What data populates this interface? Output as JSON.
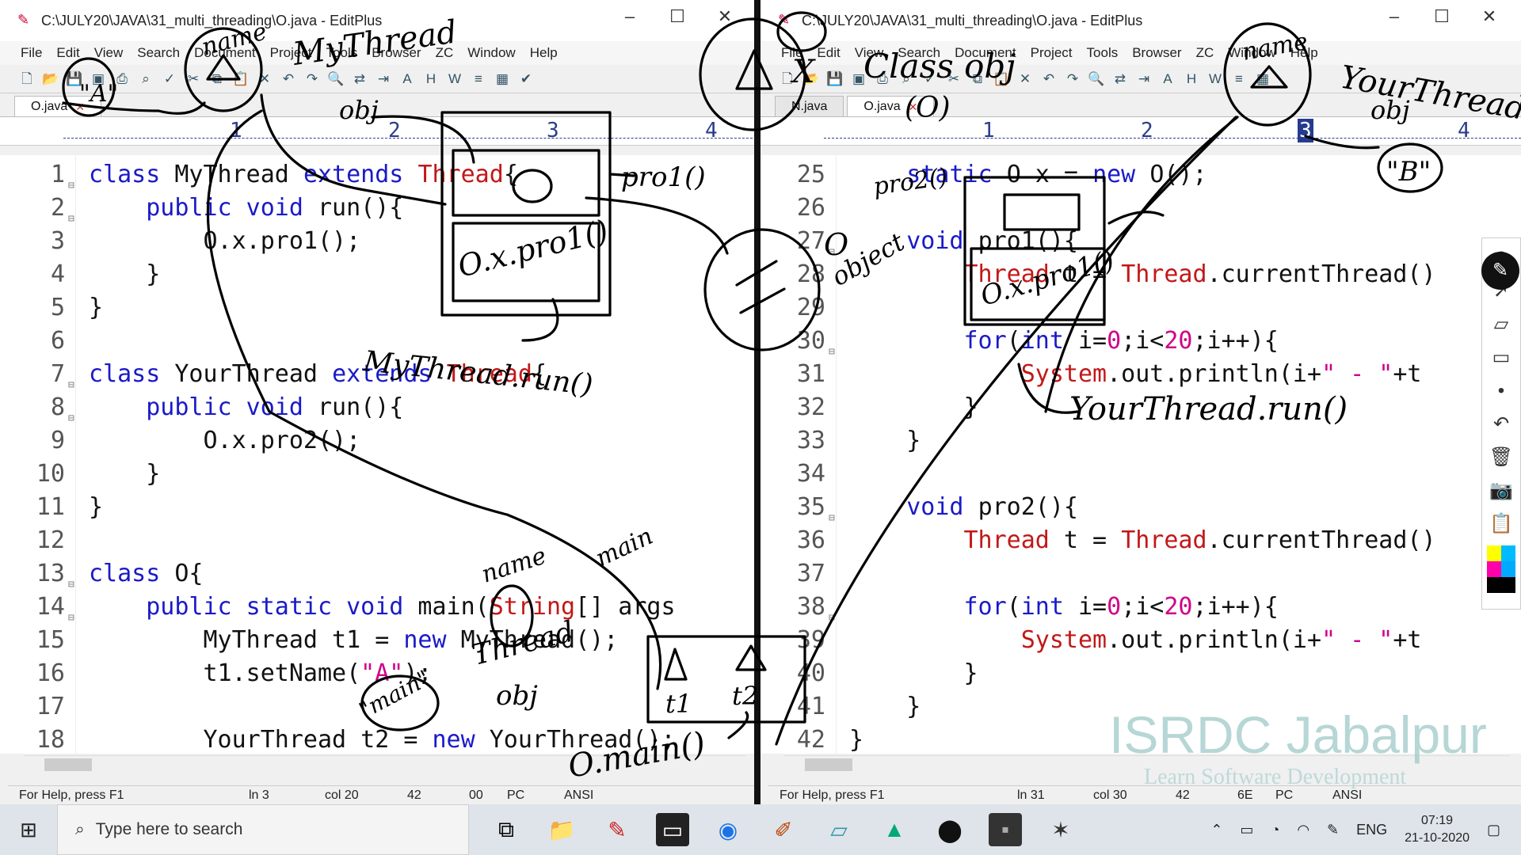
{
  "left_window": {
    "title": "C:\\JULY20\\JAVA\\31_multi_threading\\O.java - EditPlus",
    "menu": [
      "File",
      "Edit",
      "View",
      "Search",
      "Document",
      "Project",
      "Tools",
      "Browser",
      "ZC",
      "Window",
      "Help"
    ],
    "tabs": [
      {
        "label": "O.java",
        "active": true
      }
    ],
    "ruler": [
      "1",
      "2",
      "3",
      "4"
    ],
    "lines": [
      {
        "n": "1",
        "fold": "⊟",
        "segs": [
          [
            "kw",
            "class "
          ],
          [
            "txt",
            "MyThread "
          ],
          [
            "kw",
            "extends "
          ],
          [
            "cls",
            "Thread"
          ],
          [
            "txt",
            "{"
          ]
        ]
      },
      {
        "n": "2",
        "fold": "⊟",
        "segs": [
          [
            "txt",
            "    "
          ],
          [
            "kw",
            "public void "
          ],
          [
            "txt",
            "run(){"
          ]
        ]
      },
      {
        "n": "3",
        "fold": "",
        "segs": [
          [
            "txt",
            "        O.x.pro1();"
          ]
        ]
      },
      {
        "n": "4",
        "fold": "",
        "segs": [
          [
            "txt",
            "    }"
          ]
        ]
      },
      {
        "n": "5",
        "fold": "",
        "segs": [
          [
            "txt",
            "}"
          ]
        ]
      },
      {
        "n": "6",
        "fold": "",
        "segs": [
          [
            "txt",
            ""
          ]
        ]
      },
      {
        "n": "7",
        "fold": "⊟",
        "segs": [
          [
            "kw",
            "class "
          ],
          [
            "txt",
            "YourThread "
          ],
          [
            "kw",
            "extends "
          ],
          [
            "cls",
            "Thread"
          ],
          [
            "txt",
            "{"
          ]
        ]
      },
      {
        "n": "8",
        "fold": "⊟",
        "segs": [
          [
            "txt",
            "    "
          ],
          [
            "kw",
            "public void "
          ],
          [
            "txt",
            "run(){"
          ]
        ]
      },
      {
        "n": "9",
        "fold": "",
        "segs": [
          [
            "txt",
            "        O.x.pro2();"
          ]
        ]
      },
      {
        "n": "10",
        "fold": "",
        "segs": [
          [
            "txt",
            "    }"
          ]
        ]
      },
      {
        "n": "11",
        "fold": "",
        "segs": [
          [
            "txt",
            "}"
          ]
        ]
      },
      {
        "n": "12",
        "fold": "",
        "segs": [
          [
            "txt",
            ""
          ]
        ]
      },
      {
        "n": "13",
        "fold": "⊟",
        "segs": [
          [
            "kw",
            "class "
          ],
          [
            "txt",
            "O{"
          ]
        ]
      },
      {
        "n": "14",
        "fold": "⊟",
        "segs": [
          [
            "txt",
            "    "
          ],
          [
            "kw",
            "public static void "
          ],
          [
            "txt",
            "main("
          ],
          [
            "cls",
            "String"
          ],
          [
            "txt",
            "[] args"
          ]
        ]
      },
      {
        "n": "15",
        "fold": "",
        "segs": [
          [
            "txt",
            "        MyThread t1 = "
          ],
          [
            "kw",
            "new "
          ],
          [
            "txt",
            "MyThread();"
          ]
        ]
      },
      {
        "n": "16",
        "fold": "",
        "segs": [
          [
            "txt",
            "        t1.setName("
          ],
          [
            "str",
            "\"A\""
          ],
          [
            "txt",
            ");"
          ]
        ]
      },
      {
        "n": "17",
        "fold": "",
        "segs": [
          [
            "txt",
            ""
          ]
        ]
      },
      {
        "n": "18",
        "fold": "",
        "segs": [
          [
            "txt",
            "        YourThread t2 = "
          ],
          [
            "kw",
            "new "
          ],
          [
            "txt",
            "YourThread();"
          ]
        ]
      }
    ],
    "status": {
      "help": "For Help, press F1",
      "ln": "ln 3",
      "col": "col 20",
      "n1": "42",
      "n2": "00",
      "mode": "PC",
      "enc": "ANSI"
    }
  },
  "right_window": {
    "title": "C:\\JULY20\\JAVA\\31_multi_threading\\O.java - EditPlus",
    "menu": [
      "File",
      "Edit",
      "View",
      "Search",
      "Document",
      "Project",
      "Tools",
      "Browser",
      "ZC",
      "Window",
      "Help"
    ],
    "tabs": [
      {
        "label": "N.java",
        "active": false
      },
      {
        "label": "O.java",
        "active": true
      }
    ],
    "ruler": [
      "1",
      "2",
      "3",
      "4"
    ],
    "lines": [
      {
        "n": "25",
        "fold": "",
        "segs": [
          [
            "txt",
            "    "
          ],
          [
            "kw",
            "static "
          ],
          [
            "txt",
            "O x = "
          ],
          [
            "kw",
            "new "
          ],
          [
            "txt",
            "O();"
          ]
        ]
      },
      {
        "n": "26",
        "fold": "",
        "segs": [
          [
            "txt",
            ""
          ]
        ]
      },
      {
        "n": "27",
        "fold": "⊟",
        "segs": [
          [
            "txt",
            "    "
          ],
          [
            "kw",
            "void "
          ],
          [
            "txt",
            "pro1(){"
          ]
        ]
      },
      {
        "n": "28",
        "fold": "",
        "segs": [
          [
            "txt",
            "        "
          ],
          [
            "cls",
            "Thread"
          ],
          [
            "txt",
            " t = "
          ],
          [
            "cls",
            "Thread"
          ],
          [
            "txt",
            ".currentThread()"
          ]
        ]
      },
      {
        "n": "29",
        "fold": "",
        "segs": [
          [
            "txt",
            ""
          ]
        ]
      },
      {
        "n": "30",
        "fold": "⊟",
        "segs": [
          [
            "txt",
            "        "
          ],
          [
            "kw",
            "for"
          ],
          [
            "txt",
            "("
          ],
          [
            "kw",
            "int "
          ],
          [
            "txt",
            "i="
          ],
          [
            "num",
            "0"
          ],
          [
            "txt",
            ";i<"
          ],
          [
            "num",
            "20"
          ],
          [
            "txt",
            ";i++){"
          ]
        ]
      },
      {
        "n": "31",
        "fold": "",
        "segs": [
          [
            "txt",
            "            "
          ],
          [
            "cls",
            "System"
          ],
          [
            "txt",
            ".out.println(i+"
          ],
          [
            "str",
            "\" - \""
          ],
          [
            "txt",
            "+t"
          ]
        ]
      },
      {
        "n": "32",
        "fold": "",
        "segs": [
          [
            "txt",
            "        }"
          ]
        ]
      },
      {
        "n": "33",
        "fold": "",
        "segs": [
          [
            "txt",
            "    }"
          ]
        ]
      },
      {
        "n": "34",
        "fold": "",
        "segs": [
          [
            "txt",
            ""
          ]
        ]
      },
      {
        "n": "35",
        "fold": "⊟",
        "segs": [
          [
            "txt",
            "    "
          ],
          [
            "kw",
            "void "
          ],
          [
            "txt",
            "pro2(){"
          ]
        ]
      },
      {
        "n": "36",
        "fold": "",
        "segs": [
          [
            "txt",
            "        "
          ],
          [
            "cls",
            "Thread"
          ],
          [
            "txt",
            " t = "
          ],
          [
            "cls",
            "Thread"
          ],
          [
            "txt",
            ".currentThread()"
          ]
        ]
      },
      {
        "n": "37",
        "fold": "",
        "segs": [
          [
            "txt",
            ""
          ]
        ]
      },
      {
        "n": "38",
        "fold": "⊟",
        "segs": [
          [
            "txt",
            "        "
          ],
          [
            "kw",
            "for"
          ],
          [
            "txt",
            "("
          ],
          [
            "kw",
            "int "
          ],
          [
            "txt",
            "i="
          ],
          [
            "num",
            "0"
          ],
          [
            "txt",
            ";i<"
          ],
          [
            "num",
            "20"
          ],
          [
            "txt",
            ";i++){"
          ]
        ]
      },
      {
        "n": "39",
        "fold": "",
        "segs": [
          [
            "txt",
            "            "
          ],
          [
            "cls",
            "System"
          ],
          [
            "txt",
            ".out.println(i+"
          ],
          [
            "str",
            "\" - \""
          ],
          [
            "txt",
            "+t"
          ]
        ]
      },
      {
        "n": "40",
        "fold": "",
        "segs": [
          [
            "txt",
            "        }"
          ]
        ]
      },
      {
        "n": "41",
        "fold": "",
        "segs": [
          [
            "txt",
            "    }"
          ]
        ]
      },
      {
        "n": "42",
        "fold": "",
        "segs": [
          [
            "txt",
            "}"
          ]
        ]
      }
    ],
    "status": {
      "help": "For Help, press F1",
      "ln": "ln 31",
      "col": "col 30",
      "n1": "42",
      "n2": "6E",
      "mode": "PC",
      "enc": "ANSI"
    }
  },
  "annotations": {
    "name1": "name",
    "mythread": "MyThread",
    "obj1": "obj",
    "a": "\"A\"",
    "pro1": "pro1()",
    "oxpro1": "O.x.pro1()",
    "mythread_run": "MyThread.run()",
    "name2": "name",
    "main1": "main",
    "main2": "\"main\"",
    "thread_obj": "Thread",
    "obj2": "obj",
    "t1": "t1",
    "t2": "t2",
    "omain": "O.main()",
    "x": "X",
    "class_obj": "Class obj",
    "o": "(O)",
    "pro2": "pro2()",
    "object": "object",
    "o2": "O",
    "oxpro1b": "O.x.pro1()",
    "yourthread_run": "YourThread.run()",
    "name3": "name",
    "yourthread": "YourThread",
    "obj3": "obj",
    "b": "\"B\""
  },
  "watermark": {
    "title": "ISRDC Jabalpur",
    "subtitle": "Learn Software Development"
  },
  "taskbar": {
    "search_placeholder": "Type here to search",
    "lang": "ENG",
    "time": "07:19",
    "date": "21-10-2020"
  }
}
